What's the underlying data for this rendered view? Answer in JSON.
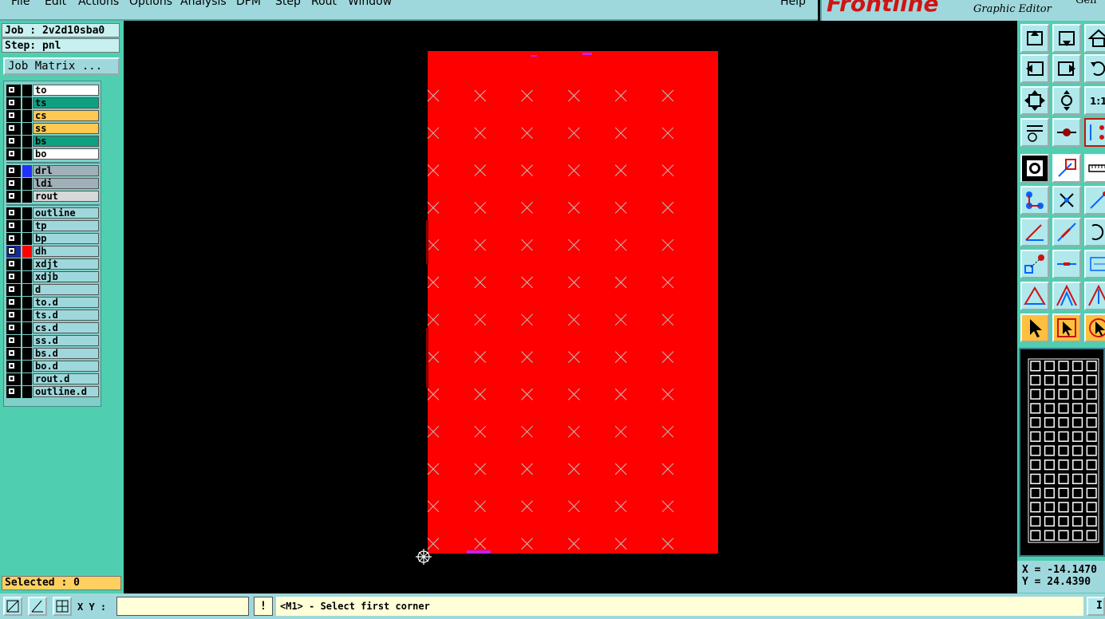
{
  "menubar": {
    "items": [
      "File",
      "Edit",
      "Actions",
      "Options",
      "Analysis",
      "DFM",
      "Step",
      "Rout",
      "Window"
    ],
    "help": "Help"
  },
  "brand": {
    "logo": "Frontline",
    "subtitle": "Graphic Editor",
    "version": "Gen"
  },
  "job": {
    "job_label": "Job : 2v2d10sba0",
    "step_label": "Step: pnl",
    "matrix_button": "Job Matrix ..."
  },
  "layers": {
    "group1": [
      {
        "name": "to",
        "color": "#ffffff"
      },
      {
        "name": "ts",
        "color": "#0fa080"
      },
      {
        "name": "cs",
        "color": "#ffc850"
      },
      {
        "name": "ss",
        "color": "#ffc850"
      },
      {
        "name": "bs",
        "color": "#0fa080"
      },
      {
        "name": "bo",
        "color": "#ffffff"
      }
    ],
    "group2": [
      {
        "name": "drl",
        "color": "#a0b0b8",
        "swatch": "#2030ff"
      },
      {
        "name": "ldi",
        "color": "#a0b0b8"
      },
      {
        "name": "rout",
        "color": "#d8d8d8"
      }
    ],
    "group3": [
      {
        "name": "outline",
        "color": "#9fd8dc"
      },
      {
        "name": "tp",
        "color": "#9fd8dc"
      },
      {
        "name": "bp",
        "color": "#9fd8dc"
      },
      {
        "name": "dh",
        "color": "#9fd8dc",
        "swatch": "#ff0000",
        "active": true
      },
      {
        "name": "xdjt",
        "color": "#9fd8dc"
      },
      {
        "name": "xdjb",
        "color": "#9fd8dc"
      },
      {
        "name": "d",
        "color": "#9fd8dc"
      },
      {
        "name": "to.d",
        "color": "#9fd8dc"
      },
      {
        "name": "ts.d",
        "color": "#9fd8dc"
      },
      {
        "name": "cs.d",
        "color": "#9fd8dc"
      },
      {
        "name": "ss.d",
        "color": "#9fd8dc"
      },
      {
        "name": "bs.d",
        "color": "#9fd8dc"
      },
      {
        "name": "bo.d",
        "color": "#9fd8dc"
      },
      {
        "name": "rout.d",
        "color": "#9fd8dc"
      },
      {
        "name": "outline.d",
        "color": "#9fd8dc"
      }
    ]
  },
  "selected": "Selected : 0",
  "coords": {
    "x": "X = -14.1470",
    "y": "Y = 24.4390"
  },
  "bottom": {
    "xy_label": "X Y :",
    "xy_value": "",
    "excl": "!",
    "prompt": "<M1> - Select first corner",
    "info_button": "I"
  },
  "panel_fill_color": "#ff0000",
  "marker_color": "#c0c0c0"
}
